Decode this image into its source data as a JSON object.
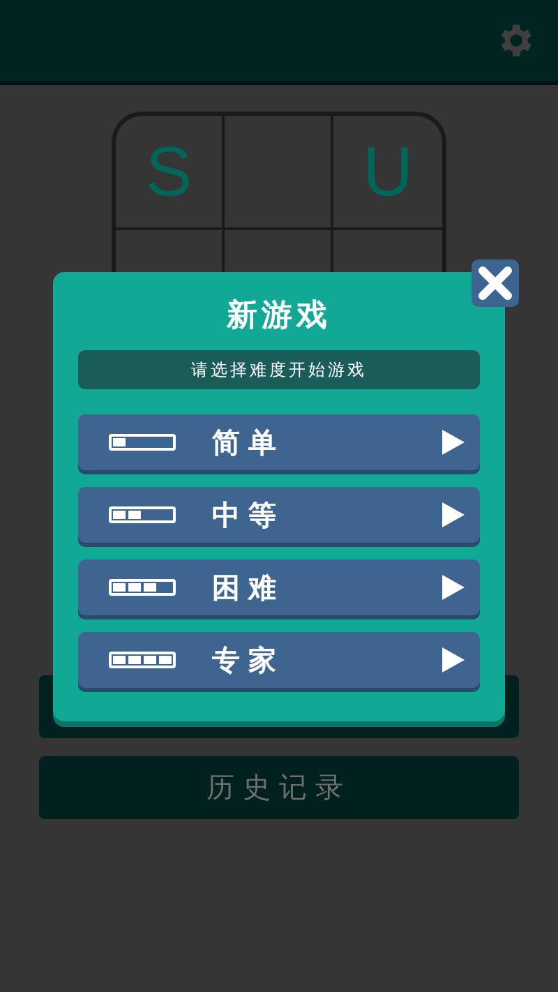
{
  "board": {
    "cells": [
      "S",
      null,
      "U"
    ]
  },
  "menu": {
    "history_button": "历史记录"
  },
  "dialog": {
    "title": "新游戏",
    "subtitle": "请选择难度开始游戏",
    "options": [
      {
        "label": "简单",
        "level": 0.25
      },
      {
        "label": "中等",
        "level": 0.5
      },
      {
        "label": "困难",
        "level": 0.75
      },
      {
        "label": "专家",
        "level": 1
      }
    ]
  }
}
